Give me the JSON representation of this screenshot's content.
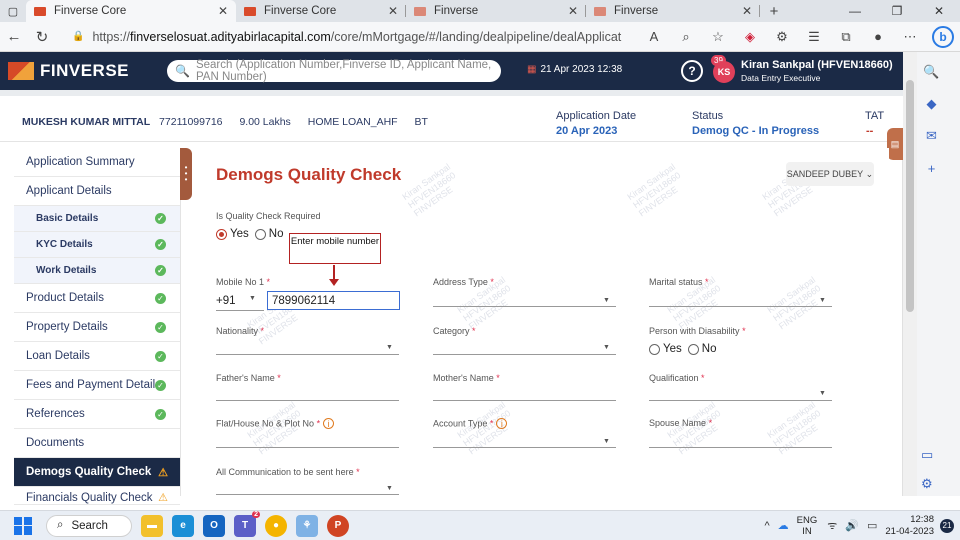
{
  "browser": {
    "tabs": [
      {
        "label": "Finverse Core",
        "active": true
      },
      {
        "label": "Finverse Core",
        "active": false
      },
      {
        "label": "Finverse",
        "active": false
      },
      {
        "label": "Finverse",
        "active": false
      }
    ],
    "url_prefix": "https://",
    "url_host": "finverselosuat.adityabirlacapital.com",
    "url_path": "/core/mMortgage/#/landing/dealpipeline/dealApplication/Demo...",
    "url_badge": "5",
    "extension_badge": "2"
  },
  "header": {
    "logo_text": "FINVERSE",
    "search_placeholder": "Search (Application Number,Finverse ID, Applicant Name, PAN Number)",
    "date_time": "21 Apr 2023 12:38",
    "notification_count": "39",
    "avatar_initials": "KS",
    "user_name": "Kiran Sankpal (HFVEN18660)",
    "user_role": "Data Entry Executive"
  },
  "infobar": {
    "customer_name": "MUKESH KUMAR MITTAL",
    "phone": "77211099716",
    "amount": "9.00 Lakhs",
    "product": "HOME LOAN_AHF",
    "code": "BT",
    "application_date_label": "Application Date",
    "application_date": "20 Apr 2023",
    "status_label": "Status",
    "status": "Demog QC - In Progress",
    "tat_label": "TAT",
    "tat": "--"
  },
  "sidebar": {
    "items": [
      {
        "label": "Application Summary"
      },
      {
        "label": "Applicant Details"
      },
      {
        "label": "Basic Details"
      },
      {
        "label": "KYC Details"
      },
      {
        "label": "Work Details"
      },
      {
        "label": "Product Details"
      },
      {
        "label": "Property Details"
      },
      {
        "label": "Loan Details"
      },
      {
        "label": "Fees and Payment Details"
      },
      {
        "label": "References"
      },
      {
        "label": "Documents"
      },
      {
        "label": "Demogs Quality Check"
      },
      {
        "label": "Financials Quality Check"
      }
    ]
  },
  "main": {
    "title": "Demogs Quality Check",
    "assignee": "SANDEEP DUBEY",
    "qc_required_label": "Is Quality Check Required",
    "yes": "Yes",
    "no": "No",
    "callout": "Enter mobile number",
    "mobile_label": "Mobile No 1",
    "country_code": "+91",
    "mobile_value": "7899062114",
    "address_type_label": "Address Type",
    "marital_status_label": "Marital status",
    "nationality_label": "Nationality",
    "category_label": "Category",
    "disability_label": "Person with Diasability",
    "father_label": "Father's Name",
    "mother_label": "Mother's Name",
    "qualification_label": "Qualification",
    "flat_label": "Flat/House No & Plot No",
    "account_type_label": "Account Type",
    "spouse_label": "Spouse Name",
    "communication_label": "All Communication to be sent here",
    "required_mark": "*",
    "watermark_line1": "Kiran Sankpal",
    "watermark_line2": "HFVEN18660",
    "watermark_line3": "FINVERSE"
  },
  "taskbar": {
    "search_label": "Search",
    "teams_badge": "2",
    "lang_line1": "ENG",
    "lang_line2": "IN",
    "time": "12:38",
    "date": "21-04-2023",
    "notification_count": "21"
  }
}
